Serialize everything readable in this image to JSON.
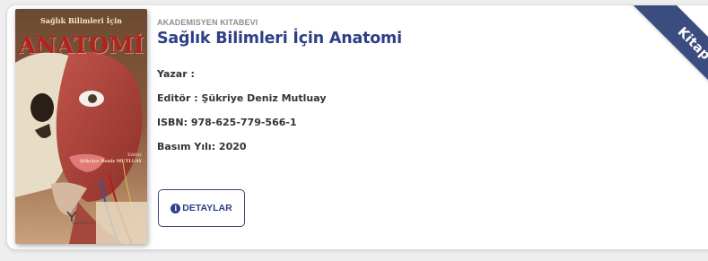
{
  "book": {
    "cover": {
      "subtitle": "Sağlık Bilimleri İçin",
      "title": "ANATOMİ",
      "editor_label": "Editör",
      "editor_name": "Şükriye Deniz MUTLUAY",
      "logo_text": "AKADEMİSYEN"
    },
    "publisher": "AKADEMISYEN KITABEVI",
    "title": "Sağlık Bilimleri İçin Anatomi",
    "author": "Yazar :",
    "editor": "Editör : Şükriye Deniz Mutluay",
    "isbn": "ISBN: 978-625-779-566-1",
    "edition_year": "Basım Yılı: 2020"
  },
  "actions": {
    "details_label": "DETAYLAR",
    "details_icon": "info-circle-icon"
  },
  "ribbon": {
    "label": "Kitap"
  },
  "colors": {
    "primary": "#2f3f86",
    "ribbon": "#3b4d7e",
    "publisher_text": "#8d8d8d",
    "meta_text": "#33333a",
    "page_bg": "#eeeeee",
    "card_bg": "#ffffff"
  }
}
